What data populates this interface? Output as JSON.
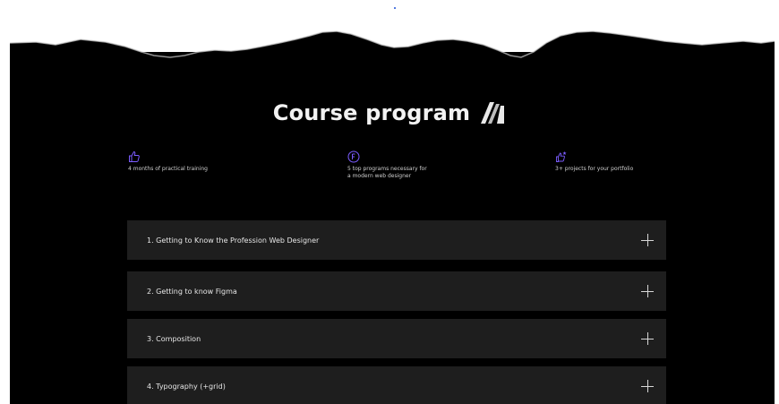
{
  "section": {
    "title": "Course program",
    "logo_icon": "stripe-logo-icon",
    "accent_color": "#7b5cff"
  },
  "features": [
    {
      "icon": "thumbs-up-icon",
      "text": "4 months of practical training"
    },
    {
      "icon": "figma-badge-icon",
      "text_line1": "5 top programs necessary for",
      "text_line2": "a modern web designer"
    },
    {
      "icon": "star-thumb-icon",
      "text": "3+ projects for your portfolio"
    }
  ],
  "modules": [
    {
      "label": "1. Getting to Know the Profession Web Designer",
      "icon": "plus-icon"
    },
    {
      "label": "2. Getting to know Figma",
      "icon": "plus-icon"
    },
    {
      "label": "3. Composition",
      "icon": "plus-icon"
    },
    {
      "label": "4. Typography (+grid)",
      "icon": "plus-icon"
    }
  ]
}
